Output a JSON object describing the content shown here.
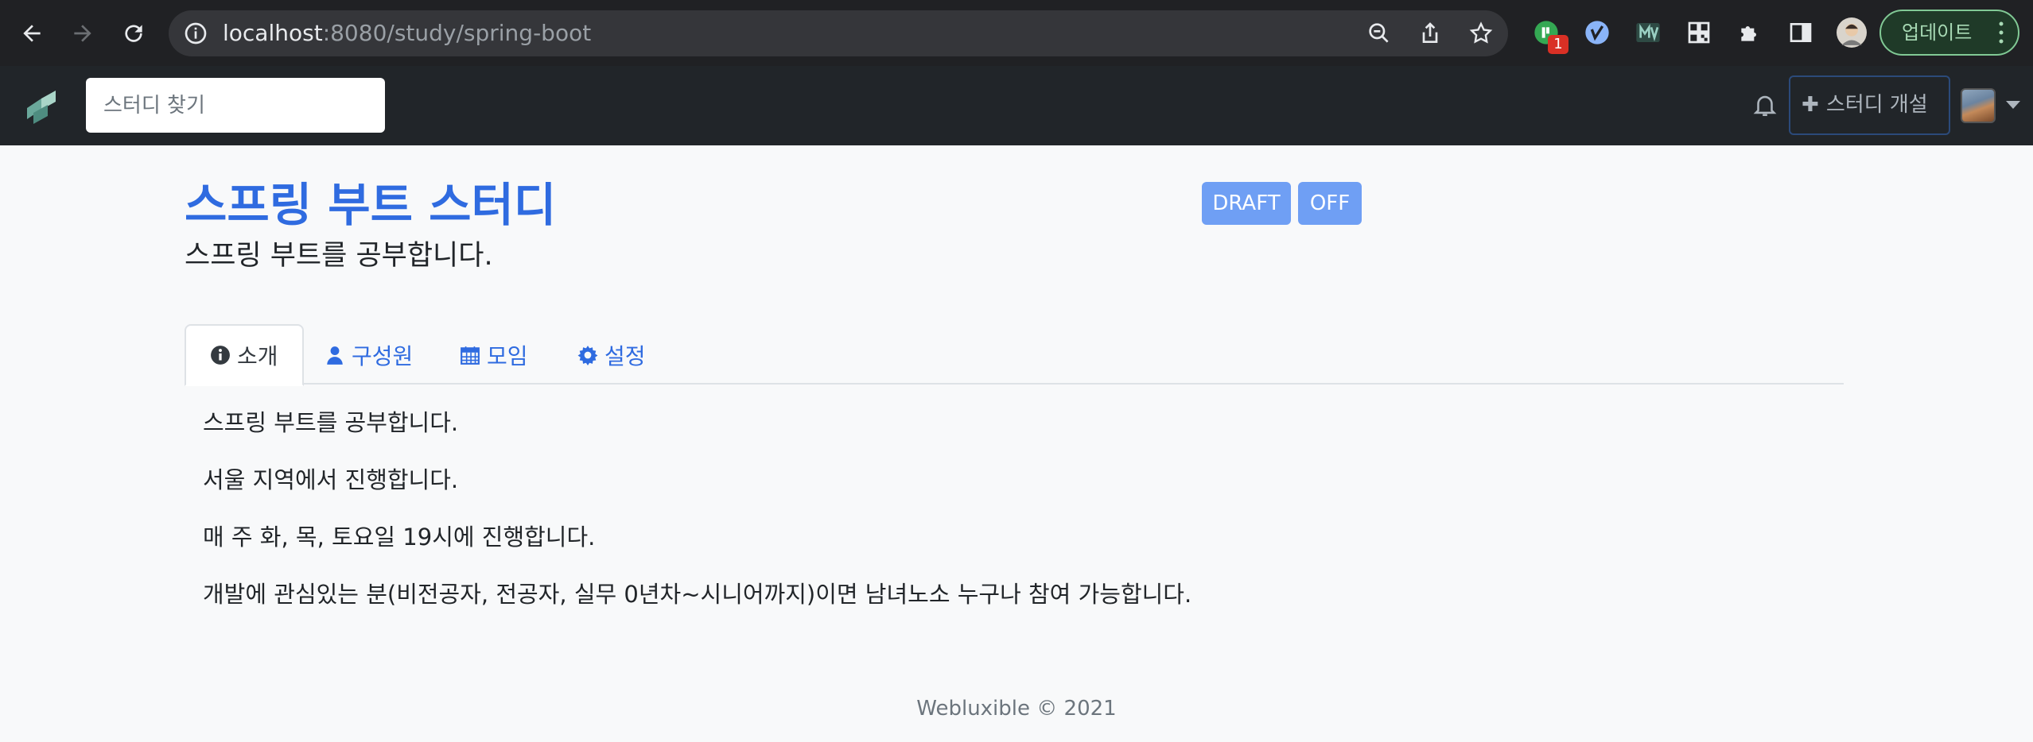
{
  "browser": {
    "url_host": "localhost",
    "url_path": ":8080/study/spring-boot",
    "extension_badge": "1",
    "update_label": "업데이트"
  },
  "navbar": {
    "search_placeholder": "스터디 찾기",
    "create_label": "스터디 개설"
  },
  "study": {
    "title": "스프링 부트 스터디",
    "short_description": "스프링 부트를 공부합니다.",
    "tags": [
      "DRAFT",
      "OFF"
    ]
  },
  "tabs": [
    {
      "label": "소개",
      "icon": "info-icon",
      "active": true
    },
    {
      "label": "구성원",
      "icon": "user-icon"
    },
    {
      "label": "모임",
      "icon": "calendar-icon"
    },
    {
      "label": "설정",
      "icon": "gear-icon"
    }
  ],
  "full_description": [
    "스프링 부트를 공부합니다.",
    "서울 지역에서 진행합니다.",
    "매 주 화, 목, 토요일 19시에 진행합니다.",
    "개발에 관심있는 분(비전공자, 전공자, 실무 0년차~시니어까지)이면 남녀노소 누구나 참여 가능합니다."
  ],
  "footer": "Webluxible © 2021",
  "colors": {
    "accent": "#2f6be0",
    "tag": "#6f9ff4",
    "navbar": "#212529"
  }
}
